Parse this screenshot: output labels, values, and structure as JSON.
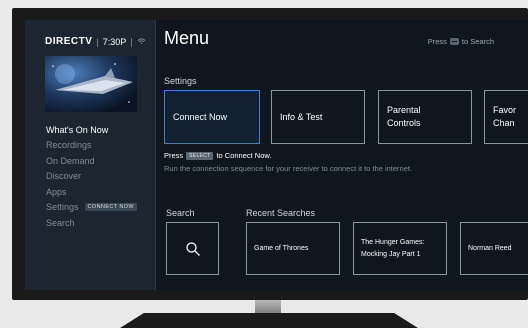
{
  "brand": {
    "logo": "DIRECTV",
    "time": "7:30P"
  },
  "sidebar": {
    "items": [
      {
        "label": "What's On Now",
        "active": true
      },
      {
        "label": "Recordings"
      },
      {
        "label": "On Demand"
      },
      {
        "label": "Discover"
      },
      {
        "label": "Apps"
      },
      {
        "label": "Settings",
        "badge": "CONNECT NOW"
      },
      {
        "label": "Search"
      }
    ]
  },
  "main": {
    "title": "Menu",
    "hint": {
      "prefix": "Press",
      "suffix": "to Search",
      "key_icon": "minus-key-icon"
    },
    "settings": {
      "label": "Settings",
      "tiles": [
        {
          "label": "Connect Now",
          "focused": true
        },
        {
          "label": "Info & Test"
        },
        {
          "line1": "Parental",
          "line2": "Controls"
        },
        {
          "line1": "Favor",
          "line2": "Chan"
        }
      ]
    },
    "info": {
      "press": "Press",
      "key": "SELECT",
      "action": "to Connect Now.",
      "description": "Run the connection sequence for your receiver to connect it to the internet."
    },
    "search": {
      "label": "Search",
      "icon": "search-icon"
    },
    "recent": {
      "label": "Recent Searches",
      "items": [
        {
          "line1": "Game of Thrones"
        },
        {
          "line1": "The Hunger Games:",
          "line2": "Mocking Jay Part 1"
        },
        {
          "line1": "Norman Reed"
        }
      ]
    }
  },
  "colors": {
    "focus_border": "#3a7fd6",
    "screen_bg": "#10161e",
    "sidebar_bg": "#1d2630"
  }
}
